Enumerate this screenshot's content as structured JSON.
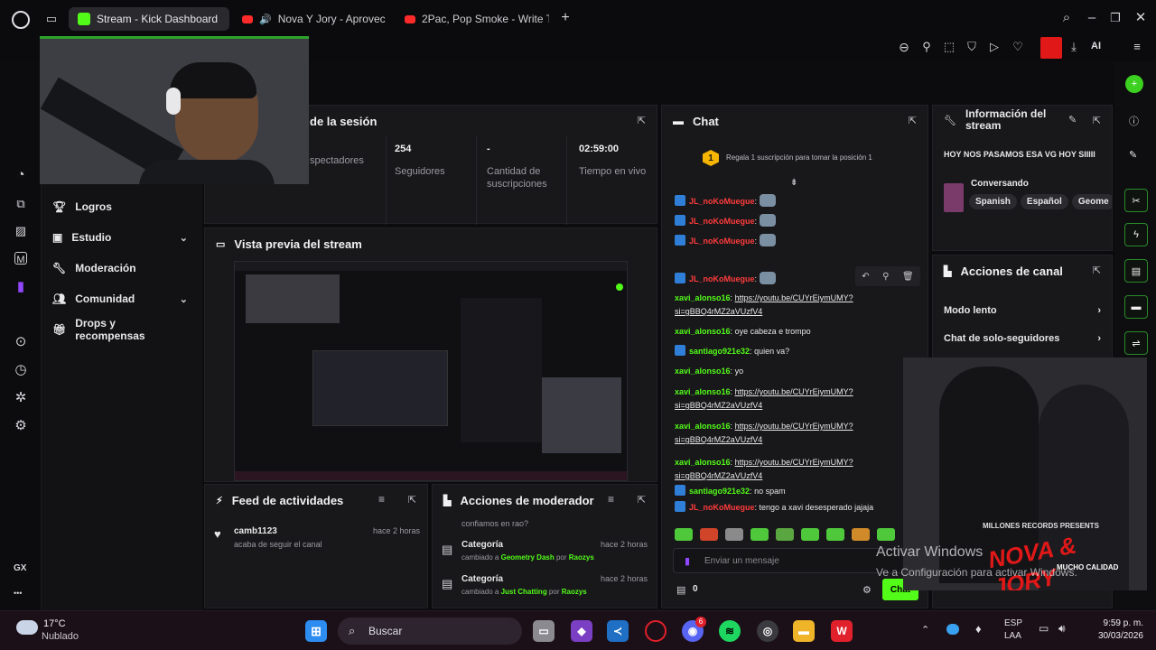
{
  "browser": {
    "tabs": [
      {
        "label": "Stream - Kick Dashboard",
        "color": "#53fc18",
        "active": true
      },
      {
        "label": "Nova Y Jory - Aprovec",
        "color": "#ff2a2a",
        "active": false
      },
      {
        "label": "2Pac, Pop Smoke - Write T",
        "color": "#ff2a2a",
        "active": false
      }
    ],
    "new_tab": "+",
    "ai_label": "AI",
    "icons": [
      "opera-logo-icon",
      "tab-manager-icon",
      "search-icon",
      "minimize-icon",
      "restore-icon",
      "close-icon"
    ]
  },
  "sidebar": {
    "items": [
      {
        "label": "Logros",
        "icon": "trophy-icon",
        "has_chevron": false
      },
      {
        "label": "Estudio",
        "icon": "video-icon",
        "has_chevron": true
      },
      {
        "label": "Moderación",
        "icon": "wrench-icon",
        "has_chevron": false
      },
      {
        "label": "Comunidad",
        "icon": "people-icon",
        "has_chevron": true
      },
      {
        "label": "Drops y recompensas",
        "icon": "gift-icon",
        "has_chevron": false
      }
    ],
    "gx_label": "GX",
    "more": "•••"
  },
  "session": {
    "title": "de la sesión",
    "stats": [
      {
        "value": "",
        "label": "spectadores"
      },
      {
        "value": "254",
        "label": "Seguidores"
      },
      {
        "value": "-",
        "label": "Cantidad de suscripciones"
      },
      {
        "value": "02:59:00",
        "label": "Tiempo en vivo"
      }
    ]
  },
  "preview": {
    "title": "Vista previa del stream"
  },
  "feed": {
    "title": "Feed de actividades",
    "items": [
      {
        "user": "camb1123",
        "time": "hace 2 horas",
        "desc": "acaba de seguir el canal"
      }
    ]
  },
  "modactions": {
    "title": "Acciones de moderador",
    "top_text": "confiamos en rao?",
    "items": [
      {
        "title": "Categoría",
        "time": "hace 2 horas",
        "prefix": "cambiado a ",
        "value": "Geometry Dash",
        "mid": " por ",
        "by": "Raozys"
      },
      {
        "title": "Categoría",
        "time": "hace 2 horas",
        "prefix": "cambiado a ",
        "value": "Just Chatting",
        "mid": " por ",
        "by": "Raozys"
      }
    ]
  },
  "chat": {
    "title": "Chat",
    "pinned_number": "1",
    "pinned_text": "Regala 1 suscripción para tomar la posición 1",
    "messages": [
      {
        "user": "JL_noKoMuegue",
        "sep": ":",
        "text": "",
        "link": "",
        "link2": "",
        "emote": true,
        "red": true
      },
      {
        "user": "JL_noKoMuegue",
        "sep": ":",
        "text": "",
        "link": "",
        "link2": "",
        "emote": true,
        "red": true
      },
      {
        "user": "JL_noKoMuegue",
        "sep": ":",
        "text": "",
        "link": "",
        "link2": "",
        "emote": true,
        "red": true
      },
      {
        "user": "JL_noKoMuegue",
        "sep": ":",
        "text": "",
        "link": "",
        "link2": "",
        "emote": true,
        "red": true
      },
      {
        "user": "xavi_alonso16",
        "sep": ":",
        "text": " ",
        "link": "https://youtu.be/CUYrEiymUMY?",
        "link2": "si=gBBQ4rMZ2aVUzfV4",
        "emote": false,
        "red": false
      },
      {
        "user": "xavi_alonso16",
        "sep": ":",
        "text": " oye cabeza e trompo",
        "link": "",
        "link2": "",
        "emote": false,
        "red": false
      },
      {
        "user": "santiago921e32",
        "sep": ":",
        "text": " quien va?",
        "link": "",
        "link2": "",
        "emote": false,
        "red": false
      },
      {
        "user": "xavi_alonso16",
        "sep": ":",
        "text": " yo",
        "link": "",
        "link2": "",
        "emote": false,
        "red": false
      },
      {
        "user": "xavi_alonso16",
        "sep": ":",
        "text": " ",
        "link": "https://youtu.be/CUYrEiymUMY?",
        "link2": "si=gBBQ4rMZ2aVUzfV4",
        "emote": false,
        "red": false
      },
      {
        "user": "xavi_alonso16",
        "sep": ":",
        "text": " ",
        "link": "https://youtu.be/CUYrEiymUMY?",
        "link2": "si=gBBQ4rMZ2aVUzfV4",
        "emote": false,
        "red": false
      },
      {
        "user": "xavi_alonso16",
        "sep": ":",
        "text": " ",
        "link": "https://youtu.be/CUYrEiymUMY?",
        "link2": "si=gBBQ4rMZ2aVUzfV4",
        "emote": false,
        "red": false
      },
      {
        "user": "santiago921e32",
        "sep": ":",
        "text": " no spam",
        "link": "",
        "link2": "",
        "emote": false,
        "red": false
      },
      {
        "user": "JL_noKoMuegue",
        "sep": ":",
        "text": " tengo a xavi desesperado jajaja",
        "link": "",
        "link2": "",
        "emote": false,
        "red": true
      }
    ],
    "input_placeholder": "Enviar un mensaje",
    "send_label": "Chat",
    "viewer_count": "0"
  },
  "info": {
    "title": "Información del stream",
    "stream_title": "HOY NOS PASAMOS ESA VG HOY SIIIII",
    "category": "Conversando",
    "tags": [
      "Spanish",
      "Español",
      "Geome"
    ]
  },
  "channel_actions": {
    "title": "Acciones de canal",
    "items": [
      "Modo lento",
      "Chat de solo-seguidores"
    ]
  },
  "overlay": {
    "album_brand": "MILLONES RECORDS PRESENTS",
    "album_title": "NOVA & JORY",
    "album_subtitle": "MUCHO CALIDAD",
    "activate_title": "Activar Windows",
    "activate_sub": "Ve a Configuración para activar Windows."
  },
  "taskbar": {
    "temp": "17°C",
    "weather": "Nublado",
    "search_label": "Buscar",
    "lang": "ESP",
    "lang2": "LAA",
    "time": "9:59 p. m.",
    "date": "30/03/2026",
    "discord_badge": "6"
  },
  "colors": {
    "accent": "#53fc18",
    "brand_red": "#ff2a2a",
    "panel": "#18181b"
  }
}
